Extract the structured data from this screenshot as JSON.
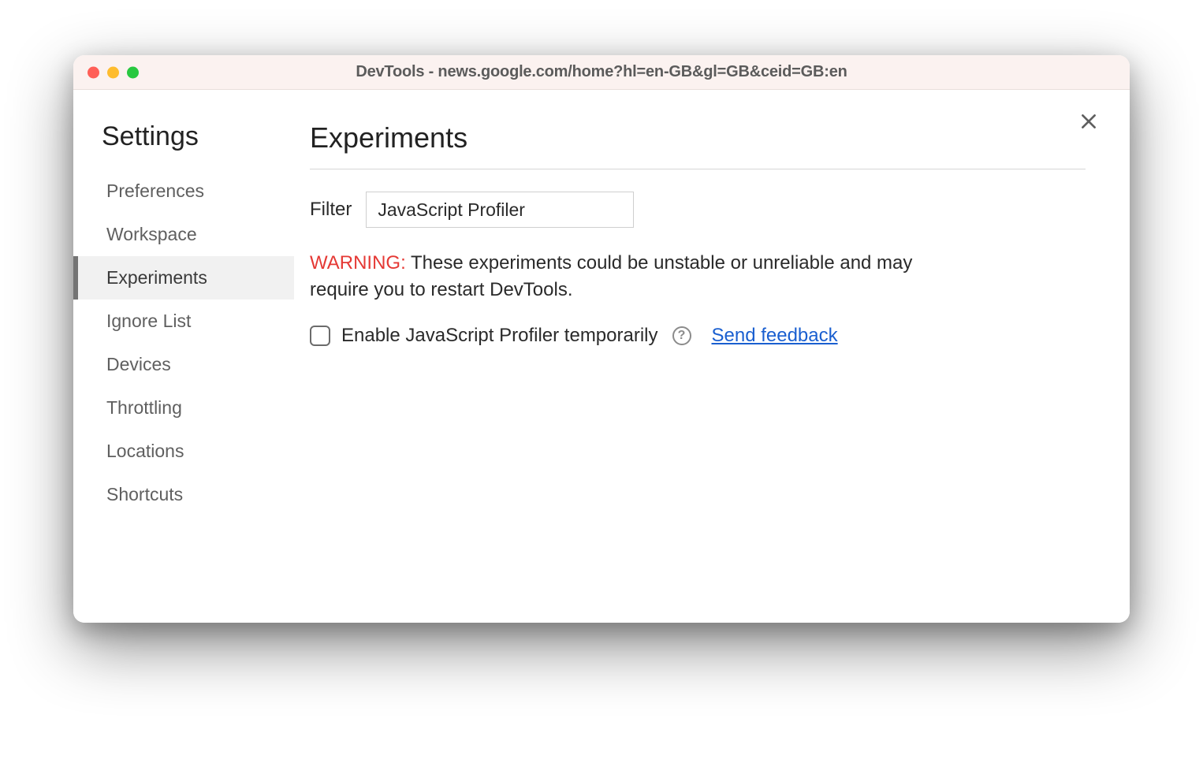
{
  "window": {
    "title": "DevTools - news.google.com/home?hl=en-GB&gl=GB&ceid=GB:en"
  },
  "sidebar": {
    "title": "Settings",
    "items": [
      {
        "label": "Preferences",
        "selected": false
      },
      {
        "label": "Workspace",
        "selected": false
      },
      {
        "label": "Experiments",
        "selected": true
      },
      {
        "label": "Ignore List",
        "selected": false
      },
      {
        "label": "Devices",
        "selected": false
      },
      {
        "label": "Throttling",
        "selected": false
      },
      {
        "label": "Locations",
        "selected": false
      },
      {
        "label": "Shortcuts",
        "selected": false
      }
    ]
  },
  "main": {
    "title": "Experiments",
    "filter": {
      "label": "Filter",
      "value": "JavaScript Profiler"
    },
    "warning": {
      "prefix": "WARNING:",
      "text": " These experiments could be unstable or unreliable and may require you to restart DevTools."
    },
    "experiment": {
      "label": "Enable JavaScript Profiler temporarily",
      "checked": false,
      "help_glyph": "?",
      "feedback_label": "Send feedback"
    }
  }
}
